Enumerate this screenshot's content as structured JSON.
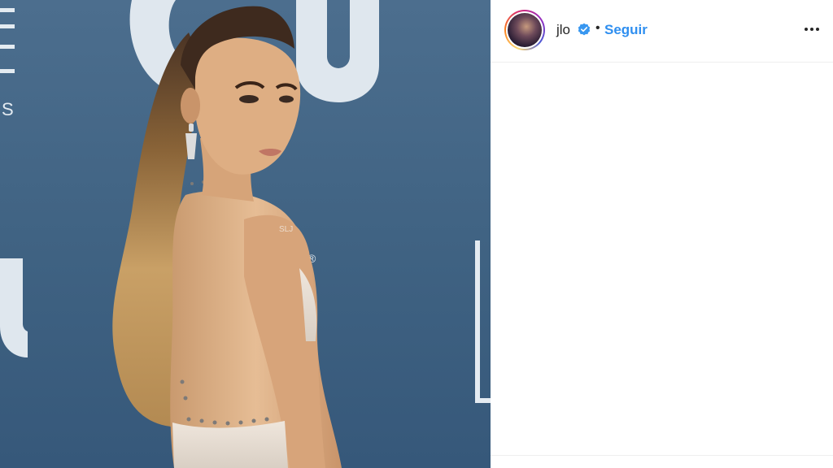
{
  "post": {
    "username": "jlo",
    "verified": true,
    "separator": "•",
    "follow_label": "Seguir",
    "options_icon": "more-horizontal-icon"
  },
  "photo": {
    "watermark": "SLJ",
    "backdrop_logo_letters": [
      "C",
      "U",
      "U"
    ],
    "side_text": [
      "HO",
      "S"
    ],
    "registered_mark": "®"
  },
  "colors": {
    "follow_blue": "#2f8ff0",
    "backdrop_blue": "#436687",
    "text_dark": "#262626",
    "divider": "#efefef"
  }
}
